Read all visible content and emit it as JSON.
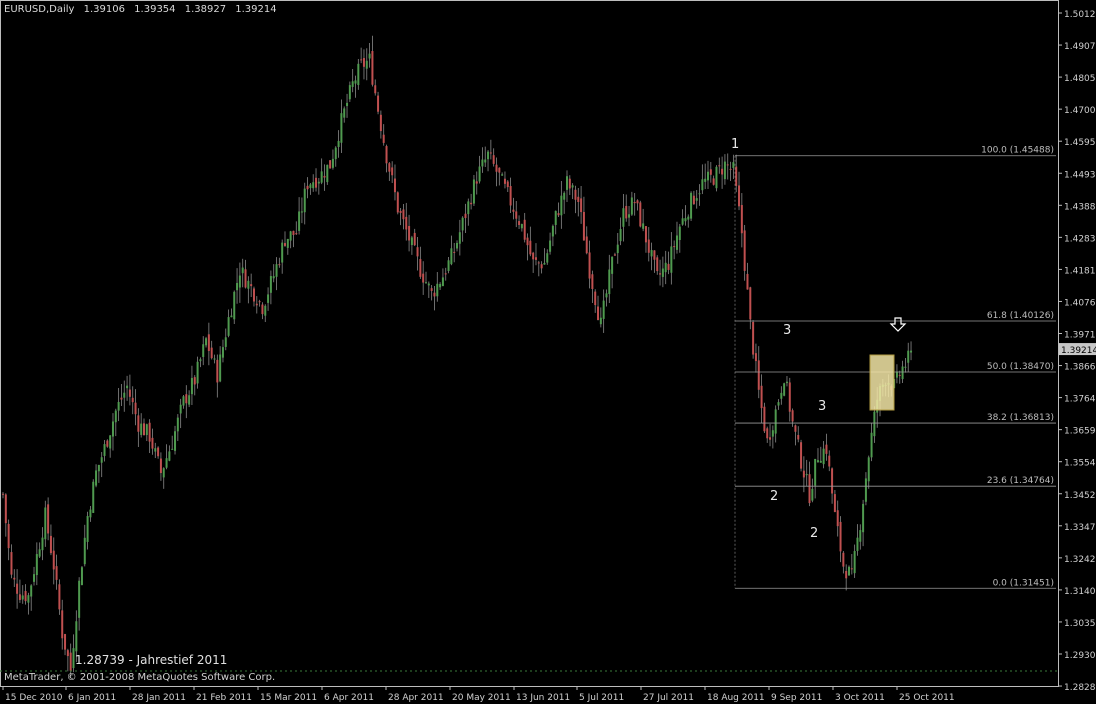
{
  "header": {
    "symbol": "EURUSD,Daily",
    "open": "1.39106",
    "high": "1.39354",
    "low": "1.38927",
    "close": "1.39214"
  },
  "footer": {
    "copyright": "MetaTrader, © 2001-2008 MetaQuotes Software Corp."
  },
  "annotations": {
    "yearly_low": "1.28739 - Jahrestief 2011",
    "wave_labels": [
      "1",
      "3",
      "3",
      "2",
      "2"
    ]
  },
  "price_axis": {
    "labels": [
      "1.50120",
      "1.49070",
      "1.48050",
      "1.47000",
      "1.45950",
      "1.44930",
      "1.43880",
      "1.42830",
      "1.41810",
      "1.40760",
      "1.39710",
      "1.38660",
      "1.37640",
      "1.36590",
      "1.35540",
      "1.34520",
      "1.33470",
      "1.32420",
      "1.31400",
      "1.30350",
      "1.29300",
      "1.28280"
    ],
    "current_price": "1.39214"
  },
  "time_axis": {
    "labels": [
      "15 Dec 2010",
      "6 Jan 2011",
      "28 Jan 2011",
      "21 Feb 2011",
      "15 Mar 2011",
      "6 Apr 2011",
      "28 Apr 2011",
      "20 May 2011",
      "13 Jun 2011",
      "5 Jul 2011",
      "27 Jul 2011",
      "18 Aug 2011",
      "9 Sep 2011",
      "3 Oct 2011",
      "25 Oct 2011"
    ]
  },
  "fibonacci": {
    "levels": [
      {
        "label": "100.0 (1.45488)",
        "price": 1.45488
      },
      {
        "label": "61.8 (1.40126)",
        "price": 1.40126
      },
      {
        "label": "50.0 (1.38470)",
        "price": 1.3847
      },
      {
        "label": "38.2 (1.36813)",
        "price": 1.36813
      },
      {
        "label": "23.6 (1.34764)",
        "price": 1.34764
      },
      {
        "label": "0.0 (1.31451)",
        "price": 1.31451
      }
    ]
  },
  "colors": {
    "background": "#000000",
    "bull_candle": "#4f9a4f",
    "bear_candle": "#c05050",
    "fib_line": "#9a9a9a",
    "highlight_box": "#f3e6a6",
    "current_price_tag": "#c8c8c8"
  },
  "icons": {
    "signal_arrow": "down-arrow-icon"
  }
}
